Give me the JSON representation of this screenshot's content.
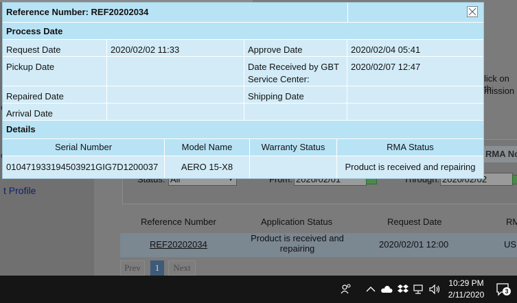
{
  "background": {
    "sidebar_chars": [
      "e",
      "u",
      "e"
    ],
    "profile_link": "t Profile",
    "help_line_1": "lick on th",
    "help_line_2": "mission",
    "rma_no_label": "RMA No.",
    "status_label": "Status:",
    "status_value": "All",
    "from_label": "From:",
    "from_value": "2020/02/01",
    "through_label": "Through:",
    "through_value": "2020/02/02",
    "table_headers": [
      "Reference Number",
      "Application Status",
      "Request Date",
      "RM"
    ],
    "row": {
      "reference": "REF20202034",
      "status_line1": "Product is received and",
      "status_line2": "repairing",
      "request_date": "2020/02/01 12:00",
      "rma_partial": "US"
    },
    "pager": {
      "prev": "Prev",
      "current": "1",
      "next": "Next"
    }
  },
  "modal": {
    "title": "Reference Number: REF20202034",
    "process_section": "Process Date",
    "process_rows": [
      {
        "l1": "Request Date",
        "v1": "2020/02/02 11:33",
        "l2": "Approve Date",
        "v2": "2020/02/04 05:41"
      },
      {
        "l1": "Pickup Date",
        "v1": "",
        "l2": "Date Received by GBT Service Center:",
        "v2": "2020/02/07 12:47"
      },
      {
        "l1": "Repaired Date",
        "v1": "",
        "l2": "Shipping Date",
        "v2": ""
      },
      {
        "l1": "Arrival Date",
        "v1": "",
        "l2": "",
        "v2": ""
      }
    ],
    "details_section": "Details",
    "details_headers": [
      "Serial Number",
      "Model Name",
      "Warranty Status",
      "RMA Status"
    ],
    "details_row": {
      "serial": "010471933194503921GIG7D1200037",
      "model": "AERO 15-X8",
      "warranty": "",
      "rma_status": "Product is received and repairing"
    }
  },
  "taskbar": {
    "time": "10:29 PM",
    "date": "2/11/2020",
    "notification_count": "3",
    "icons": [
      "people-icon",
      "chevron-up-icon",
      "onedrive-cloud-icon",
      "dropbox-icon",
      "network-icon",
      "volume-icon",
      "action-center-icon"
    ]
  }
}
